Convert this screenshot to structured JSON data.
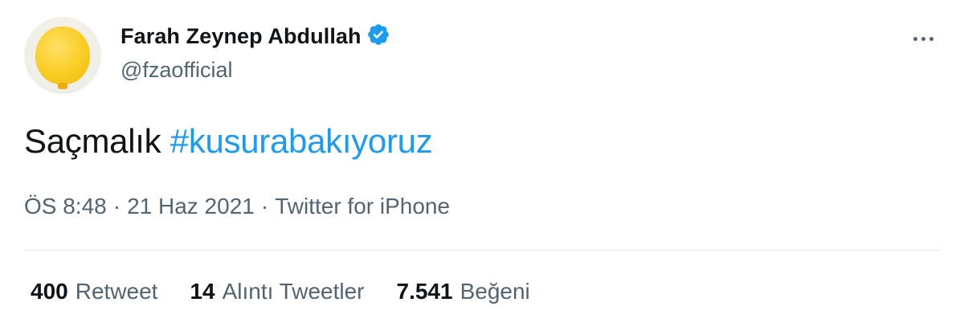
{
  "author": {
    "display_name": "Farah Zeynep Abdullah",
    "handle": "@fzaofficial",
    "verified": true,
    "verified_color": "#1d9bf0"
  },
  "tweet": {
    "text": "Saçmalık",
    "hashtag": "#kusurabakıyoruz",
    "hashtag_color": "#1d9bf0"
  },
  "meta": {
    "time": "ÖS 8:48",
    "date": "21 Haz 2021",
    "source": "Twitter for iPhone",
    "separator": "·"
  },
  "stats": [
    {
      "count": "400",
      "label": "Retweet"
    },
    {
      "count": "14",
      "label": "Alıntı Tweetler"
    },
    {
      "count": "7.541",
      "label": "Beğeni"
    }
  ],
  "icons": {
    "avatar": "yellow-balloon-avatar",
    "verified": "verified-badge-icon",
    "more": "more-options-icon"
  }
}
